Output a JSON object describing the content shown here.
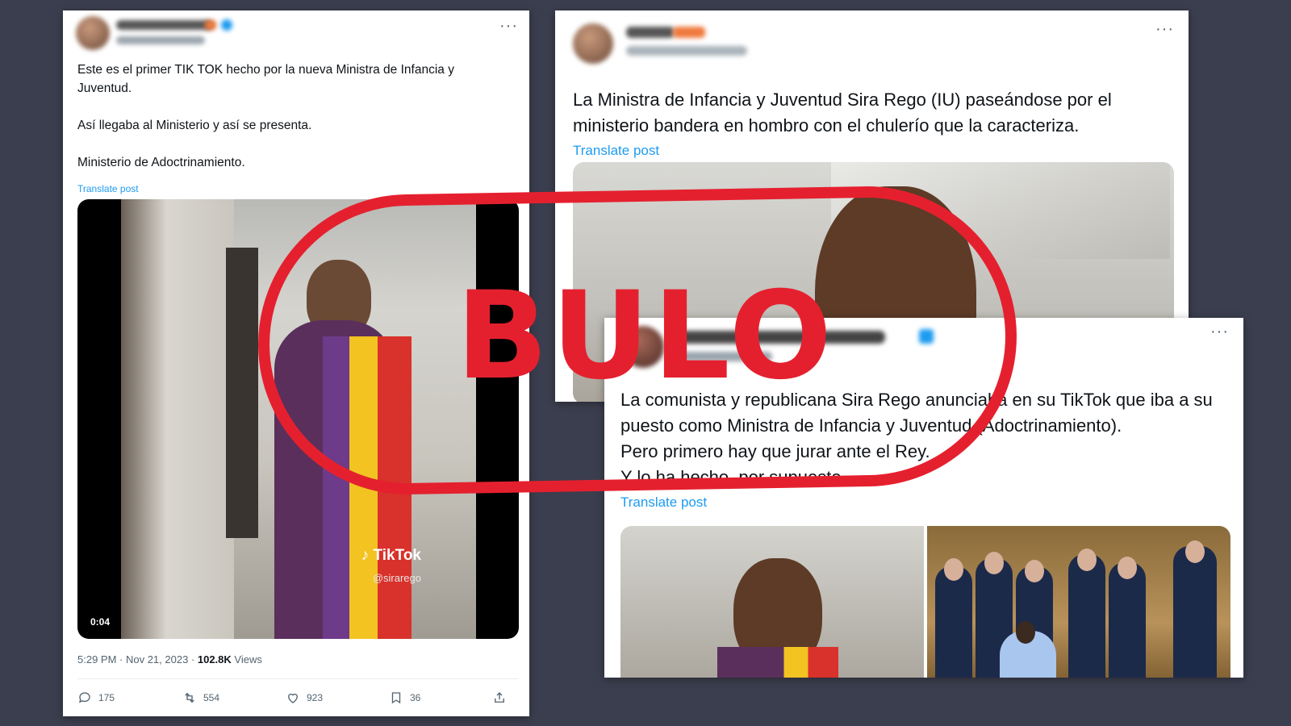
{
  "tweet1": {
    "more": "···",
    "text": "Este es el primer TIK TOK hecho por la nueva Ministra de Infancia y Juventud.\n\nAsí llegaba al Ministerio y así se presenta.\n\nMinisterio de Adoctrinamiento.",
    "translate": "Translate post",
    "video": {
      "watermark": "TikTok",
      "watermark_handle": "@sirarego",
      "duration": "0:04"
    },
    "timestamp": "5:29 PM · Nov 21, 2023 · ",
    "views_count": "102.8K",
    "views_label": " Views",
    "actions": {
      "replies": "175",
      "reposts": "554",
      "likes": "923",
      "bookmarks": "36"
    }
  },
  "tweet2": {
    "more": "···",
    "text": "La Ministra de Infancia y Juventud Sira Rego (IU) paseándose por el ministerio bandera en hombro con el chulerío que la caracteriza.",
    "translate": "Translate post"
  },
  "tweet3": {
    "more": "···",
    "text": "La comunista y republicana Sira Rego anunciaba en su TikTok que iba a su puesto como Ministra de Infancia y Juventud (Adoctrinamiento).\nPero primero hay que jurar ante el Rey.\nY lo ha hecho, por supuesto.",
    "translate": "Translate post"
  },
  "stamp": {
    "label": "BULO",
    "color": "#e5202e"
  },
  "colors": {
    "background": "#3b3e4e",
    "link": "#1d9bf0"
  }
}
